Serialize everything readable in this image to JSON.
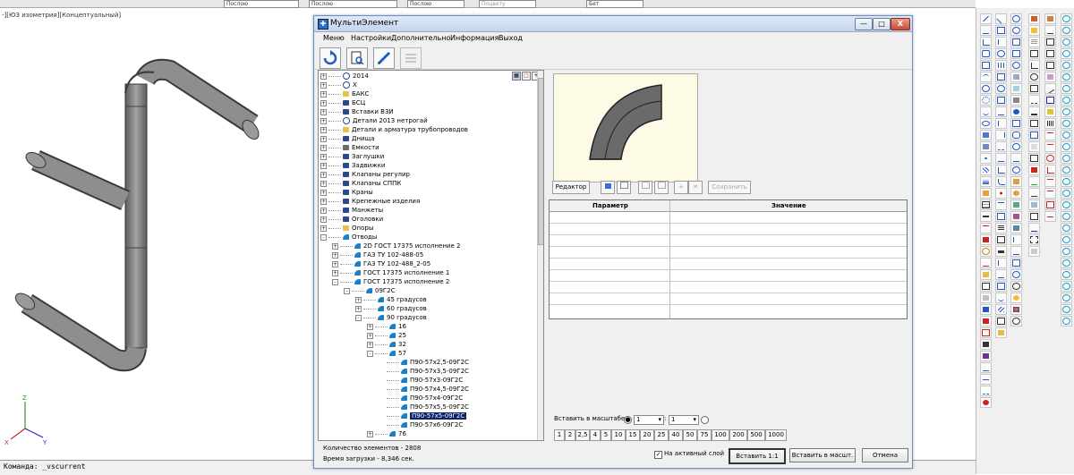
{
  "viewport": {
    "label": "-][ЮЗ изометрия][Концептуальный]"
  },
  "top_toolbar": {
    "fields": [
      "Послою",
      "Послою",
      "Послою",
      "Поцвету",
      "Бет"
    ]
  },
  "command_line": {
    "prompt": "Команда: _vscurrent"
  },
  "dialog": {
    "title": "МультиЭлемент",
    "window_buttons": [
      "—",
      "□",
      "X"
    ],
    "menu": [
      "Меню",
      "Настройки",
      "Дополнительно",
      "Информация",
      "Выход"
    ],
    "tree_items": [
      {
        "level": 0,
        "exp": "+",
        "label": "2014",
        "icon": "question-icon"
      },
      {
        "level": 0,
        "exp": "+",
        "label": "X",
        "icon": "question-icon"
      },
      {
        "level": 0,
        "exp": "+",
        "label": "БАКС",
        "icon": "folder-icon"
      },
      {
        "level": 0,
        "exp": "+",
        "label": "БСЦ",
        "icon": "pipe-icon"
      },
      {
        "level": 0,
        "exp": "+",
        "label": "Вставки ВЗИ",
        "icon": "pipe-icon"
      },
      {
        "level": 0,
        "exp": "+",
        "label": "Детали 2013 нетрогай",
        "icon": "question-icon"
      },
      {
        "level": 0,
        "exp": "+",
        "label": "Детали и арматура трубопроводов",
        "icon": "folder-icon"
      },
      {
        "level": 0,
        "exp": "+",
        "label": "Днища",
        "icon": "pipe-icon"
      },
      {
        "level": 0,
        "exp": "+",
        "label": "Емкости",
        "icon": "tank-icon"
      },
      {
        "level": 0,
        "exp": "+",
        "label": "Заглушки",
        "icon": "pipe-icon"
      },
      {
        "level": 0,
        "exp": "+",
        "label": "Задвижки",
        "icon": "valve-icon"
      },
      {
        "level": 0,
        "exp": "+",
        "label": "Клапаны регулир",
        "icon": "valve-icon"
      },
      {
        "level": 0,
        "exp": "+",
        "label": "Клапаны СППК",
        "icon": "pipe-icon"
      },
      {
        "level": 0,
        "exp": "+",
        "label": "Краны",
        "icon": "valve-icon"
      },
      {
        "level": 0,
        "exp": "+",
        "label": "Крепежные изделия",
        "icon": "pipe-icon"
      },
      {
        "level": 0,
        "exp": "+",
        "label": "Манжеты",
        "icon": "pipe-icon"
      },
      {
        "level": 0,
        "exp": "+",
        "label": "Оголовки",
        "icon": "pipe-icon"
      },
      {
        "level": 0,
        "exp": "+",
        "label": "Опоры",
        "icon": "folder-icon"
      },
      {
        "level": 0,
        "exp": "-",
        "label": "Отводы",
        "icon": "elbow-icon"
      },
      {
        "level": 1,
        "exp": "+",
        "label": "2D ГОСТ 17375 исполнение 2",
        "icon": "elbow-icon"
      },
      {
        "level": 1,
        "exp": "+",
        "label": "ГАЗ ТУ 102-488-05",
        "icon": "elbow-icon"
      },
      {
        "level": 1,
        "exp": "+",
        "label": "ГАЗ ТУ 102-488_2-05",
        "icon": "elbow-icon"
      },
      {
        "level": 1,
        "exp": "+",
        "label": "ГОСТ 17375 исполнение 1",
        "icon": "elbow-icon"
      },
      {
        "level": 1,
        "exp": "-",
        "label": "ГОСТ 17375 исполнение 2",
        "icon": "elbow-icon"
      },
      {
        "level": 2,
        "exp": "-",
        "label": "09Г2С",
        "icon": "elbow-icon"
      },
      {
        "level": 3,
        "exp": "+",
        "label": "45 градусов",
        "icon": "elbow-icon"
      },
      {
        "level": 3,
        "exp": "+",
        "label": "60 градусов",
        "icon": "elbow-icon"
      },
      {
        "level": 3,
        "exp": "-",
        "label": "90 градусов",
        "icon": "elbow-icon"
      },
      {
        "level": 4,
        "exp": "+",
        "label": "16",
        "icon": "elbow-icon"
      },
      {
        "level": 4,
        "exp": "+",
        "label": "25",
        "icon": "elbow-icon"
      },
      {
        "level": 4,
        "exp": "+",
        "label": "32",
        "icon": "elbow-icon"
      },
      {
        "level": 4,
        "exp": "-",
        "label": "57",
        "icon": "elbow-icon"
      },
      {
        "level": 5,
        "exp": "",
        "label": "П90-57х2,5-09Г2С",
        "icon": "elbow-icon"
      },
      {
        "level": 5,
        "exp": "",
        "label": "П90-57х3,5-09Г2С",
        "icon": "elbow-icon"
      },
      {
        "level": 5,
        "exp": "",
        "label": "П90-57х3-09Г2С",
        "icon": "elbow-icon"
      },
      {
        "level": 5,
        "exp": "",
        "label": "П90-57х4,5-09Г2С",
        "icon": "elbow-icon"
      },
      {
        "level": 5,
        "exp": "",
        "label": "П90-57х4-09Г2С",
        "icon": "elbow-icon"
      },
      {
        "level": 5,
        "exp": "",
        "label": "П90-57х5,5-09Г2С",
        "icon": "elbow-icon"
      },
      {
        "level": 5,
        "exp": "",
        "label": "П90-57х5-09Г2С",
        "icon": "elbow-icon",
        "selected": true
      },
      {
        "level": 5,
        "exp": "",
        "label": "П90-57х6-09Г2С",
        "icon": "elbow-icon"
      },
      {
        "level": 4,
        "exp": "+",
        "label": "76",
        "icon": "elbow-icon"
      }
    ],
    "status": {
      "count": "Количество элементов - 2808",
      "load_time": "Время загрузки - 8,346 сек."
    },
    "editor_button": "Редактор",
    "save_button": "Сохранить",
    "table": {
      "col_param": "Параметр",
      "col_value": "Значение"
    },
    "scale": {
      "label": "Вставить в масштабе",
      "value_left": "1",
      "value_right": "1",
      "buttons": [
        "1",
        "2",
        "2,5",
        "4",
        "5",
        "10",
        "15",
        "20",
        "25",
        "40",
        "50",
        "75",
        "100",
        "200",
        "500",
        "1000"
      ]
    },
    "active_layer_label": "На активный слой",
    "btn_insert_11": "Вставить 1:1",
    "btn_insert_scale": "Вставить в масшт.",
    "btn_cancel": "Отмена"
  },
  "colors": {
    "pipe": "#8c8c8c",
    "pipe_dark": "#555555",
    "elbow_icon": "#1a7fc9",
    "selection": "#0a246a",
    "preview_bg": "#fdfbe6"
  }
}
